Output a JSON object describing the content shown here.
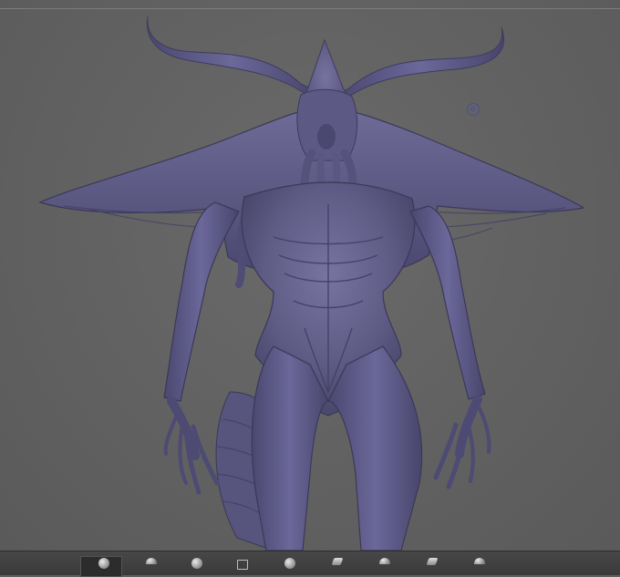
{
  "viewport": {
    "background": "#606060",
    "model_color": "#5f5c86",
    "model_shadow": "#3e3b5e",
    "model_highlight": "#8784ad"
  },
  "shelf": {
    "tools": [
      {
        "icon": "sphere-brush-icon"
      },
      {
        "icon": "clay-brush-icon"
      },
      {
        "icon": "smooth-brush-icon"
      },
      {
        "icon": "mask-icon"
      },
      {
        "icon": "move-brush-icon"
      },
      {
        "icon": "inflate-brush-icon"
      },
      {
        "icon": "pinch-brush-icon"
      },
      {
        "icon": "dam-standard-icon"
      },
      {
        "icon": "trim-brush-icon"
      }
    ]
  }
}
